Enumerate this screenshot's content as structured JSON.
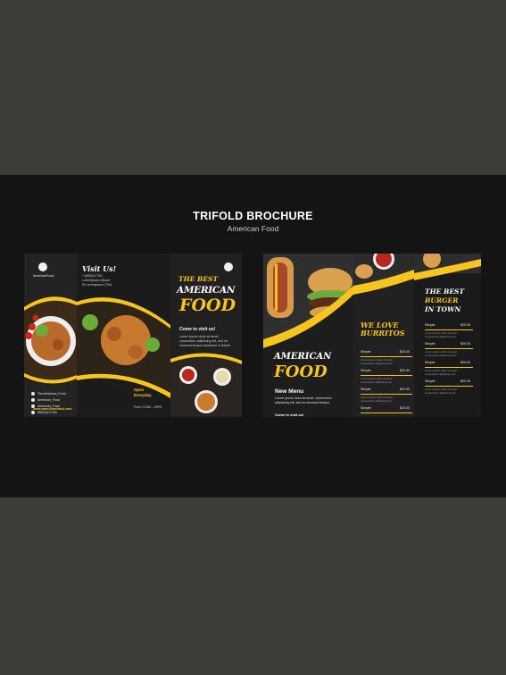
{
  "header": {
    "title": "TRIFOLD BROCHURE",
    "subtitle": "American Food"
  },
  "left_brochure": {
    "logo_text": "AmericanFood",
    "visit_title": "Visit Us!",
    "contact_lines": [
      "+1(952)07760",
      "LoremIpsum.@com",
      "St Loremipsum 2764"
    ],
    "social": [
      "The American_Food",
      "American_Food",
      "American_Food",
      "5691(0)71760"
    ],
    "website": "www.americanfood.com",
    "headline_best": "THE BEST",
    "headline_american": "AMERICAN",
    "headline_food": "FOOD",
    "come_visit": "Come to visit us!",
    "body_text": "Lorem ipsum dolor sit amet, consectetur adipiscing elit, sed do eiusmod tempor incididunt ut labore",
    "open_label": "Open",
    "open_days": "Everyday",
    "hours": "From 07AM - 10PM"
  },
  "right_brochure": {
    "american": "AMERICAN",
    "food": "FOOD",
    "new_menu": "New Menu",
    "menu_text": "Lorem ipsum dolor sit amet, consectetur adipiscing elit, sed do eiusmod tempor.",
    "come_visit": "Come to visit us!",
    "burritos_title_1": "WE LOVE",
    "burritos_title_2": "BURRITOS",
    "burger_title_1": "THE BEST",
    "burger_title_2": "BURGER",
    "burger_title_3": "IN TOWN",
    "item_name": "Simple",
    "item_price": "$20.00",
    "item_desc": "Lorem ipsum dolor sit amet consectetur adipiscing elit."
  },
  "colors": {
    "accent": "#f7c51e",
    "panel": "#1e1e1e",
    "background": "#3b3e37"
  }
}
